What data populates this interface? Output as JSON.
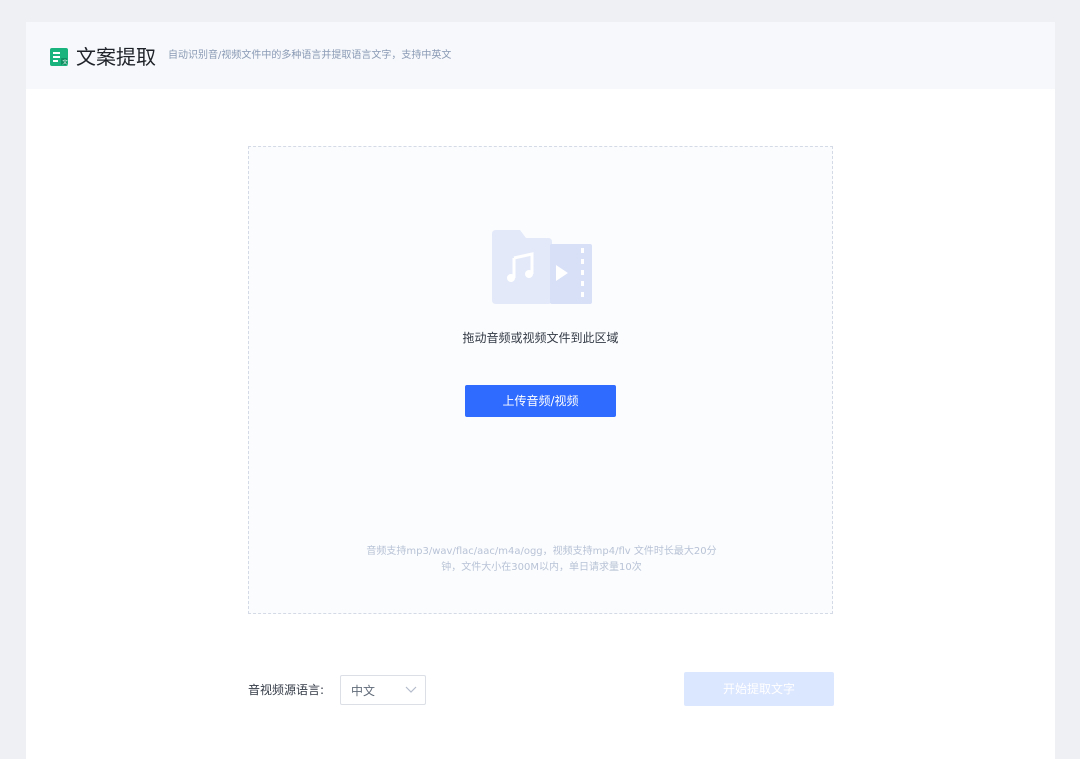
{
  "header": {
    "title": "文案提取",
    "subtitle": "自动识别音/视频文件中的多种语言并提取语言文字，支持中英文",
    "icon": "text-extract-icon",
    "accent_color": "#19b37d"
  },
  "upload": {
    "icon": "audio-video-file-icon",
    "drop_hint": "拖动音频或视频文件到此区域",
    "button_label": "上传音频/视频",
    "note_line1": "音频支持mp3/wav/flac/aac/m4a/ogg，视频支持mp4/flv 文件时长最大20分",
    "note_line2": "钟，文件大小在300M以内，单日请求量10次"
  },
  "settings": {
    "language_label": "音视频源语言:",
    "language_value": "中文",
    "start_button_label": "开始提取文字",
    "start_button_enabled": false
  },
  "colors": {
    "primary": "#2f6bff",
    "disabled_primary": "#dbe6ff",
    "page_bg": "#eef0f4"
  }
}
